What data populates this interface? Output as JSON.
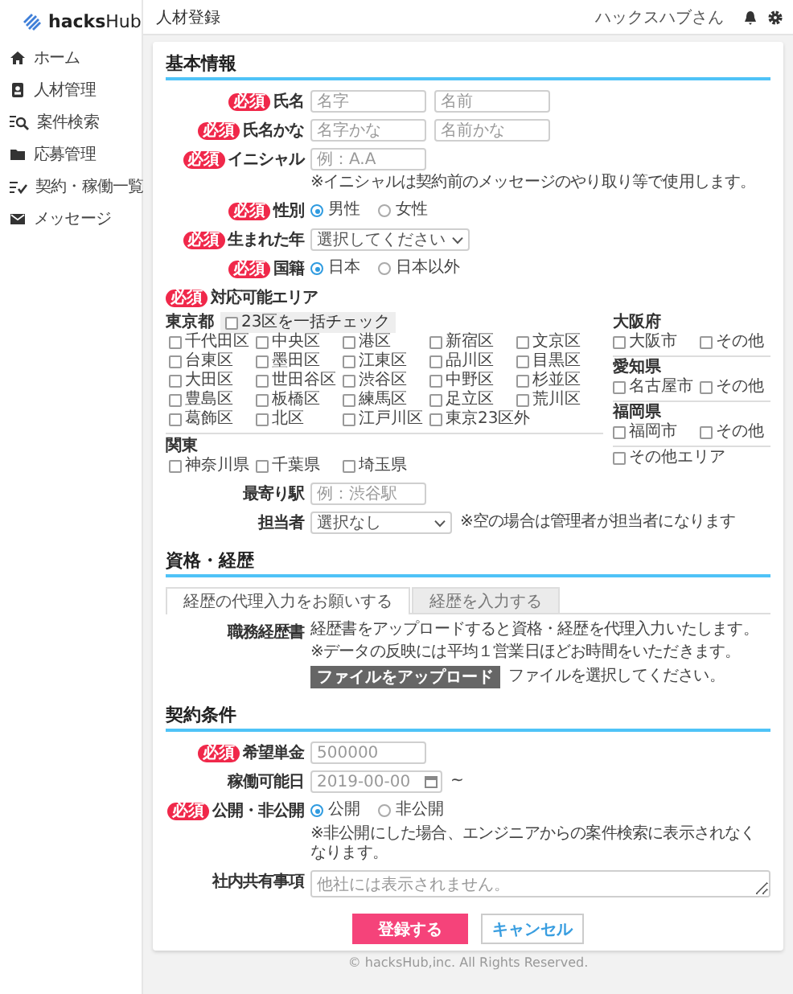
{
  "sidebar": {
    "logo": "**hacks**Hub",
    "items": [
      {
        "label": "ホーム",
        "selected": false
      },
      {
        "label": "人材管理",
        "selected": false
      },
      {
        "label": "案件検索",
        "selected": false
      },
      {
        "label": "応募管理",
        "selected": false
      },
      {
        "label": "契約・稼働一覧",
        "selected": false
      },
      {
        "label": "メッセージ",
        "selected": false
      }
    ]
  },
  "header": {
    "title": "人材登録",
    "user": "ハックスハブさん"
  },
  "sections": [
    {
      "title": "基本情報",
      "fields": [
        {
          "kind": "text",
          "badge": "必須",
          "label": "氏名",
          "inputs": [
            {
              "placeholder": "名字"
            },
            {
              "placeholder": "名前"
            }
          ]
        },
        {
          "kind": "text",
          "badge": "必須",
          "label": "氏名かな",
          "inputs": [
            {
              "placeholder": "名字かな"
            },
            {
              "placeholder": "名前かな"
            }
          ]
        },
        {
          "kind": "text",
          "badge": "必須",
          "label": "イニシャル",
          "inputs": [
            {
              "placeholder": "例：A.A"
            }
          ],
          "note": "※イニシャルは契約前のメッセージのやり取り等で使用します。"
        },
        {
          "kind": "radio",
          "badge": "必須",
          "label": "性別",
          "options": [
            {
              "label": "男性",
              "selected": true
            },
            {
              "label": "女性",
              "selected": false
            }
          ]
        },
        {
          "kind": "select",
          "badge": "必須",
          "label": "生まれた年",
          "value": "選択してください"
        },
        {
          "kind": "radio",
          "badge": "必須",
          "label": "国籍",
          "options": [
            {
              "label": "日本",
              "selected": true
            },
            {
              "label": "日本以外",
              "selected": false
            }
          ]
        },
        {
          "kind": "area",
          "badge": "必須",
          "label": "対応可能エリア",
          "groups": [
            {
              "title": "東京都",
              "bulk": {
                "label": "23区を一括チェック",
                "checked": false
              },
              "options": [
                {
                  "label": "千代田区",
                  "checked": false
                },
                {
                  "label": "中央区",
                  "checked": false
                },
                {
                  "label": "港区",
                  "checked": false
                },
                {
                  "label": "新宿区",
                  "checked": false
                },
                {
                  "label": "文京区",
                  "checked": false
                },
                {
                  "label": "台東区",
                  "checked": false
                },
                {
                  "label": "墨田区",
                  "checked": false
                },
                {
                  "label": "江東区",
                  "checked": false
                },
                {
                  "label": "品川区",
                  "checked": false
                },
                {
                  "label": "目黒区",
                  "checked": false
                },
                {
                  "label": "大田区",
                  "checked": false
                },
                {
                  "label": "世田谷区",
                  "checked": false
                },
                {
                  "label": "渋谷区",
                  "checked": false
                },
                {
                  "label": "中野区",
                  "checked": false
                },
                {
                  "label": "杉並区",
                  "checked": false
                },
                {
                  "label": "豊島区",
                  "checked": false
                },
                {
                  "label": "板橋区",
                  "checked": false
                },
                {
                  "label": "練馬区",
                  "checked": false
                },
                {
                  "label": "足立区",
                  "checked": false
                },
                {
                  "label": "荒川区",
                  "checked": false
                },
                {
                  "label": "葛飾区",
                  "checked": false
                },
                {
                  "label": "北区",
                  "checked": false
                },
                {
                  "label": "江戸川区",
                  "checked": false
                },
                {
                  "label": "東京23区外",
                  "checked": false
                }
              ]
            },
            {
              "title": "関東",
              "options": [
                {
                  "label": "神奈川県",
                  "checked": false
                },
                {
                  "label": "千葉県",
                  "checked": false
                },
                {
                  "label": "埼玉県",
                  "checked": false
                }
              ]
            }
          ],
          "side_groups": [
            {
              "title": "大阪府",
              "options": [
                {
                  "label": "大阪市",
                  "checked": false
                },
                {
                  "label": "その他",
                  "checked": false
                }
              ]
            },
            {
              "title": "愛知県",
              "options": [
                {
                  "label": "名古屋市",
                  "checked": false
                },
                {
                  "label": "その他",
                  "checked": false
                }
              ]
            },
            {
              "title": "福岡県",
              "options": [
                {
                  "label": "福岡市",
                  "checked": false
                },
                {
                  "label": "その他",
                  "checked": false
                }
              ]
            },
            {
              "options": [
                {
                  "label": "その他エリア",
                  "checked": false
                }
              ]
            }
          ]
        },
        {
          "kind": "text",
          "label": "最寄り駅",
          "inputs": [
            {
              "placeholder": "例：渋谷駅"
            }
          ]
        },
        {
          "kind": "select",
          "label": "担当者",
          "value": "選択なし",
          "note": "※空の場合は管理者が担当者になります"
        }
      ]
    },
    {
      "title": "資格・経歴",
      "tabs": [
        {
          "label": "経歴の代理入力をお願いする",
          "selected": true
        },
        {
          "label": "経歴を入力する",
          "selected": false
        }
      ],
      "fields": [
        {
          "kind": "upload",
          "label": "職務経歴書",
          "notes": [
            "経歴書をアップロードすると資格・経歴を代理入力いたします。",
            "※データの反映には平均１営業日ほどお時間をいただきます。"
          ],
          "button": "ファイルをアップロード",
          "status": "ファイルを選択してください。"
        }
      ]
    },
    {
      "title": "契約条件",
      "fields": [
        {
          "kind": "text",
          "badge": "必須",
          "label": "希望単金",
          "inputs": [
            {
              "placeholder": "500000"
            }
          ]
        },
        {
          "kind": "date",
          "label": "稼働可能日",
          "placeholder": "2019-00-00",
          "suffix": "~"
        },
        {
          "kind": "radio",
          "badge": "必須",
          "label": "公開・非公開",
          "options": [
            {
              "label": "公開",
              "selected": true
            },
            {
              "label": "非公開",
              "selected": false
            }
          ],
          "note": "※非公開にした場合、エンジニアからの案件検索に表示されなくなります。"
        },
        {
          "kind": "textarea",
          "label": "社内共有事項",
          "placeholder": "他社には表示されません。"
        }
      ]
    }
  ],
  "actions": {
    "submit": "登録する",
    "cancel": "キャンセル"
  },
  "footer": "© hacksHub,inc. All Rights Reserved."
}
